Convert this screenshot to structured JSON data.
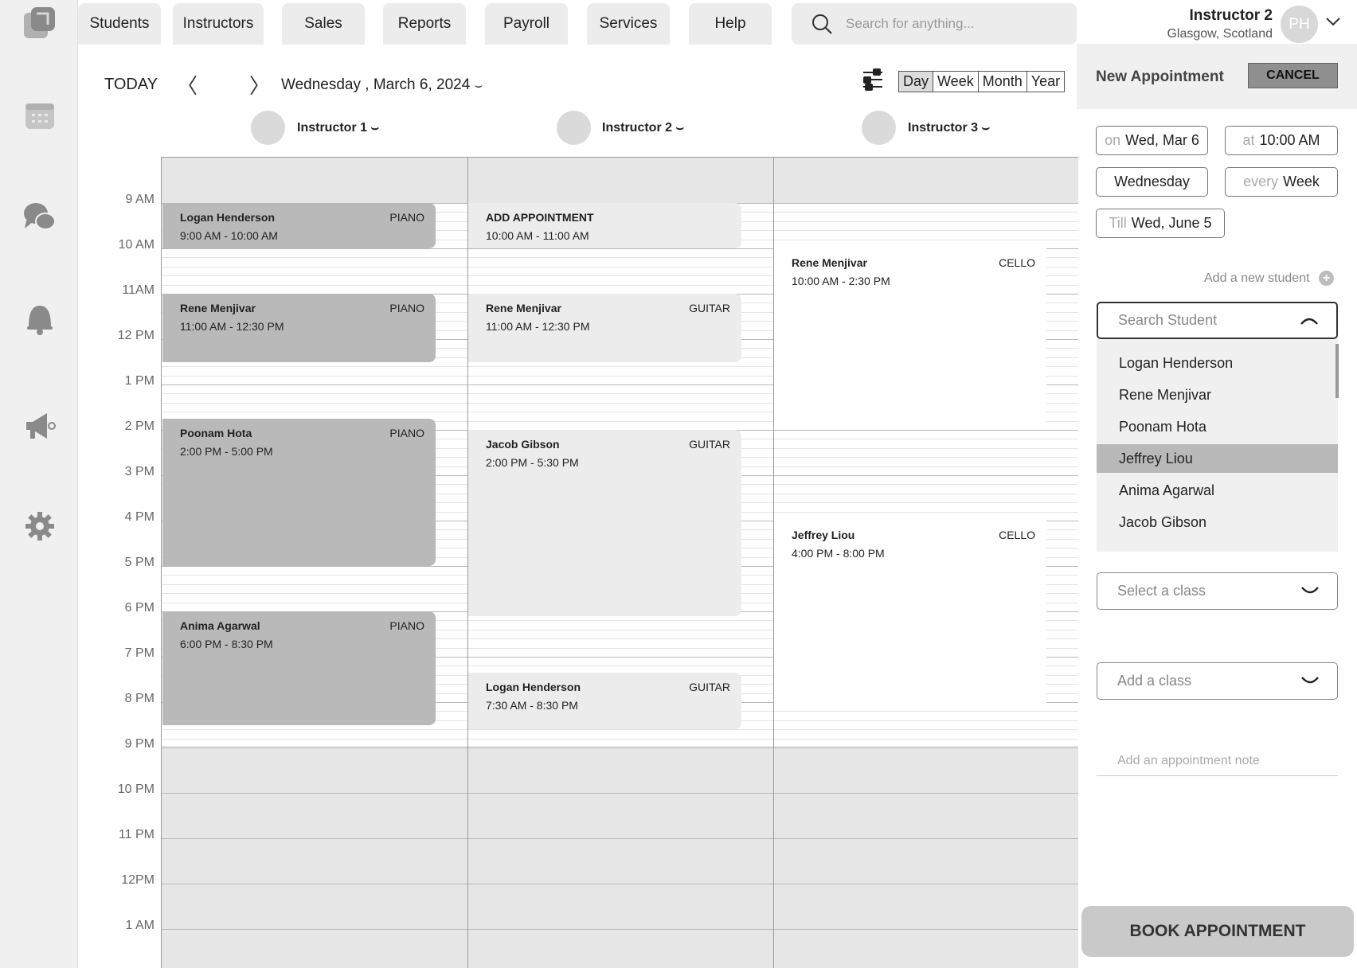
{
  "nav": {
    "tabs": [
      "Students",
      "Instructors",
      "Sales",
      "Reports",
      "Payroll",
      "Services",
      "Help"
    ],
    "search_placeholder": "Search for anything..."
  },
  "user": {
    "name": "Instructor 2",
    "location": "Glasgow, Scotland",
    "initials": "PH"
  },
  "sidebar_icons": [
    "logo-icon",
    "calendar-icon",
    "chat-icon",
    "bell-icon",
    "megaphone-icon",
    "gear-icon"
  ],
  "calendar": {
    "today_label": "TODAY",
    "prev_arrow": "〈",
    "next_arrow": "〉",
    "date": "Wednesday , March 6, 2024",
    "views": [
      "Day",
      "Week",
      "Month",
      "Year"
    ],
    "active_view": "Day",
    "instructors": [
      "Instructor 1",
      "Instructor 2",
      "Instructor 3"
    ],
    "hours": [
      "9 AM",
      "10 AM",
      "11AM",
      "12 PM",
      "1 PM",
      "2 PM",
      "3 PM",
      "4 PM",
      "5 PM",
      "6 PM",
      "7 PM",
      "8 PM",
      "9 PM",
      "10 PM",
      "11 PM",
      "12PM",
      "1 AM"
    ]
  },
  "appointments": [
    {
      "col": 0,
      "start": 9,
      "end": 10,
      "name": "Logan Henderson",
      "time": "9:00 AM - 10:00 AM",
      "class": "PIANO",
      "style": "dark"
    },
    {
      "col": 0,
      "start": 11,
      "end": 12.5,
      "name": "Rene Menjivar",
      "time": "11:00 AM - 12:30 PM",
      "class": "PIANO",
      "style": "dark"
    },
    {
      "col": 0,
      "start": 13.75,
      "end": 17,
      "name": "Poonam Hota",
      "time": "2:00 PM - 5:00 PM",
      "class": "PIANO",
      "style": "dark"
    },
    {
      "col": 0,
      "start": 18,
      "end": 20.5,
      "name": "Anima Agarwal",
      "time": "6:00 PM - 8:30 PM",
      "class": "PIANO",
      "style": "dark"
    },
    {
      "col": 1,
      "start": 9,
      "end": 10,
      "name": "ADD APPOINTMENT",
      "time": "10:00 AM - 11:00 AM",
      "class": "",
      "style": "light"
    },
    {
      "col": 1,
      "start": 11,
      "end": 12.5,
      "name": "Rene Menjivar",
      "time": "11:00 AM - 12:30 PM",
      "class": "GUITAR",
      "style": "light"
    },
    {
      "col": 1,
      "start": 14,
      "end": 18.1,
      "name": "Jacob Gibson",
      "time": "2:00 PM - 5:30 PM",
      "class": "GUITAR",
      "style": "light"
    },
    {
      "col": 1,
      "start": 19.35,
      "end": 20.6,
      "name": "Logan Henderson",
      "time": "7:30 AM - 8:30 PM",
      "class": "GUITAR",
      "style": "light"
    },
    {
      "col": 2,
      "start": 10,
      "end": 14,
      "name": "Rene Menjivar",
      "time": "10:00 AM - 2:30 PM",
      "class": "CELLO",
      "style": "white"
    },
    {
      "col": 2,
      "start": 16,
      "end": 20.1,
      "name": "Jeffrey Liou",
      "time": "4:00 PM - 8:00 PM",
      "class": "CELLO",
      "style": "white"
    }
  ],
  "panel": {
    "title": "New Appointment",
    "cancel_label": "CANCEL",
    "on_prefix": "on",
    "on_value": "Wed, Mar 6",
    "at_prefix": "at",
    "at_value": "10:00 AM",
    "day_value": "Wednesday",
    "every_prefix": "every",
    "every_value": "Week",
    "till_prefix": "Till",
    "till_value": "Wed, June 5",
    "add_student_label": "Add a new student",
    "student_search_placeholder": "Search Student",
    "students": [
      "Logan Henderson",
      "Rene Menjivar",
      "Poonam Hota",
      "Jeffrey Liou",
      "Anima Agarwal",
      "Jacob Gibson"
    ],
    "selected_student": "Jeffrey Liou",
    "select_class_placeholder": "Select a class",
    "add_class_placeholder": "Add a class",
    "note_placeholder": "Add an appointment note",
    "book_label": "BOOK APPOINTMENT"
  }
}
